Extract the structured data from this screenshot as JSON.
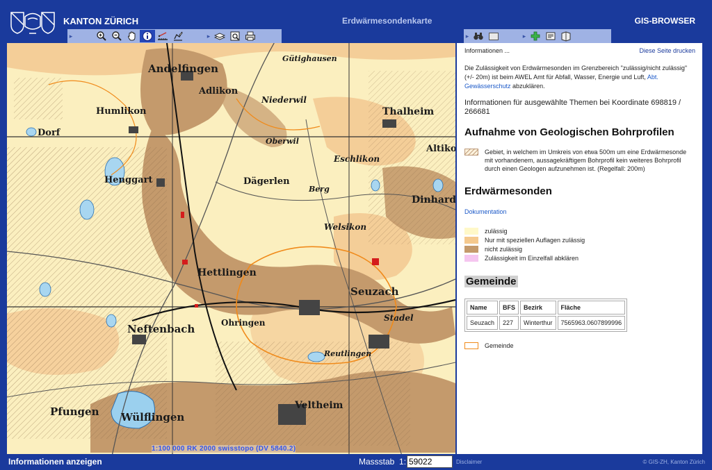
{
  "header": {
    "canton": "KANTON ZÜRICH",
    "title": "Erdwärmesondenkarte",
    "browser": "GIS-BROWSER"
  },
  "toolbar_left": [
    "zoom-in-icon",
    "zoom-out-icon",
    "pan-hand-icon",
    "info-icon",
    "measure-icon",
    "draw-icon",
    "layers-icon",
    "preview-icon",
    "print-icon"
  ],
  "toolbar_right": [
    "search-binoculars-icon",
    "overview-icon",
    "add-icon",
    "export-icon",
    "legend-icon"
  ],
  "map": {
    "labels": {
      "andelfingen": "Andelfingen",
      "adlikon": "Adlikon",
      "humlikon": "Humlikon",
      "niederwil": "Niederwil",
      "thalheim": "Thalheim",
      "gutighausen": "Gütighausen",
      "oberwil": "Oberwil",
      "eschlikon": "Eschlikon",
      "henggart": "Henggart",
      "dagerlen": "Dägerlen",
      "dinhard": "Dinhard",
      "berg": "Berg",
      "welsikon": "Welsikon",
      "hettlingen": "Hettlingen",
      "seuzach": "Seuzach",
      "neftenbach": "Neftenbach",
      "ohringen": "Ohringen",
      "pfungen": "Pfungen",
      "wulflingen": "Wülflingen",
      "veltheim": "Veltheim",
      "stadel": "Stadel",
      "reutlingen": "Reutlingen",
      "altikon": "Altikon",
      "dorf": "Dorf"
    },
    "scale_text": "1:100 000 RK 2000 swisstopo (DV 5840.2)"
  },
  "info": {
    "heading": "Informationen ...",
    "print_link": "Diese Seite drucken",
    "note_before": "Die Zulässigkeit von Erdwärmesonden im Grenzbereich \"zulässig/nicht zulässig\" (+/- 20m) ist beim AWEL Amt für Abfall, Wasser, Energie und Luft,",
    "note_link": "Abt. Gewässerschutz",
    "note_after": "abzuklären.",
    "coordinates": "Informationen für ausgewählte Themen bei Koordinate 698819 / 266681",
    "bohr_title": "Aufnahme von Geologischen Bohrprofilen",
    "bohr_text": "Gebiet, in welchem im Umkreis von etwa 500m um eine Erdwärmesonde mit vorhandenem, aussagekräftigem Bohrprofil kein weiteres Bohrprofil durch einen Geologen aufzunehmen ist. (Regelfall: 200m)",
    "ews_title": "Erdwärmesonden",
    "doc_link": "Dokumentation",
    "ews_legend": [
      {
        "label": "zulässig",
        "color": "#fff8c8"
      },
      {
        "label": "Nur mit speziellen Auflagen zulässig",
        "color": "#f5c98e"
      },
      {
        "label": "nicht zulässig",
        "color": "#c49a6c"
      },
      {
        "label": "Zulässigkeit im Einzelfall abklären",
        "color": "#f5c6f0"
      }
    ],
    "gemeinde_title": "Gemeinde",
    "table": {
      "headers": [
        "Name",
        "BFS",
        "Bezirk",
        "Fläche"
      ],
      "row": [
        "Seuzach",
        "227",
        "Winterthur",
        "7565963.0607899996"
      ]
    },
    "gemeinde_legend": "Gemeinde"
  },
  "footer": {
    "status": "Informationen anzeigen",
    "massstab_label": "Massstab  1:",
    "massstab_value": "59022",
    "disclaimer": "Disclaimer",
    "copyright": "© GIS-ZH, Kanton Zürich"
  }
}
